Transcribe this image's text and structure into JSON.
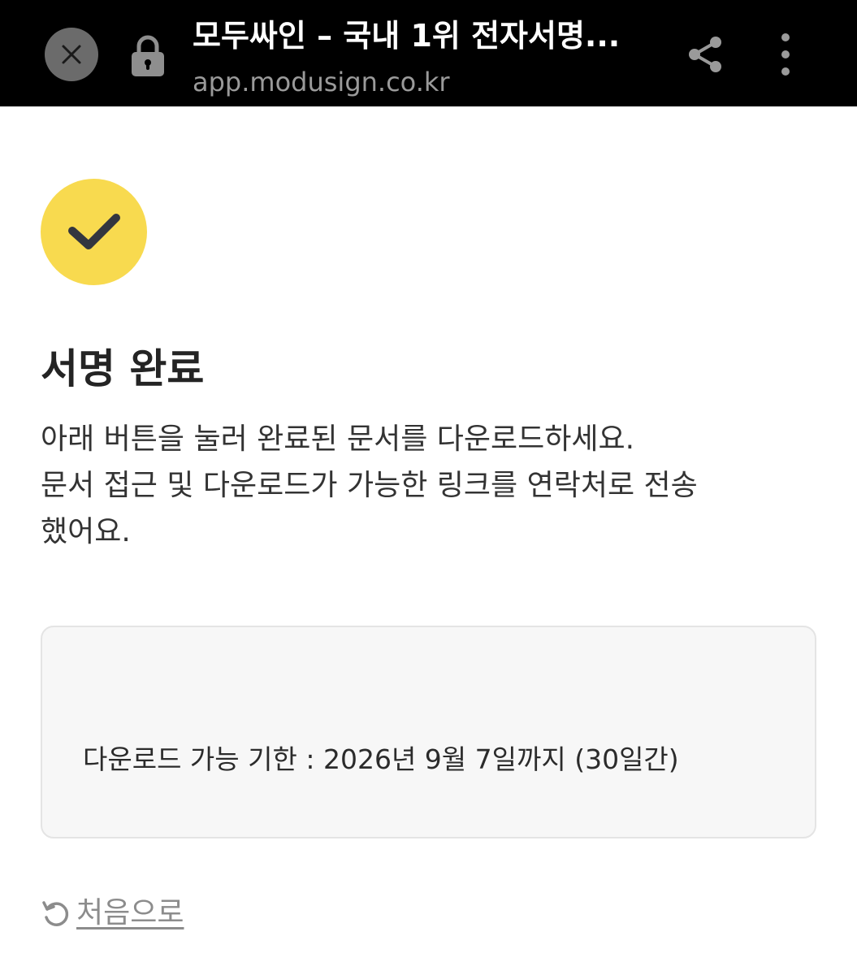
{
  "browser_bar": {
    "title": "모두싸인 – 국내 1위 전자서명...",
    "url": "app.modusign.co.kr",
    "icons": {
      "close": "close-icon",
      "lock": "lock-icon",
      "share": "share-icon",
      "menu": "more-vert-icon"
    }
  },
  "main": {
    "status_icon": "check-icon",
    "accent_color": "#f8da4f",
    "title": "서명 완료",
    "description_lines": [
      "아래 버튼을 눌러 완료된 문서를 다운로드하세요.",
      "문서 접근 및 다운로드가 가능한 링크를 연락처로 전송",
      "했어요."
    ],
    "info_card": {
      "expiry_text": "다운로드 가능 기한 : 2026년 9월 7일까지 (30일간)"
    },
    "back_link": {
      "icon": "refresh-icon",
      "label": "처음으로"
    }
  }
}
